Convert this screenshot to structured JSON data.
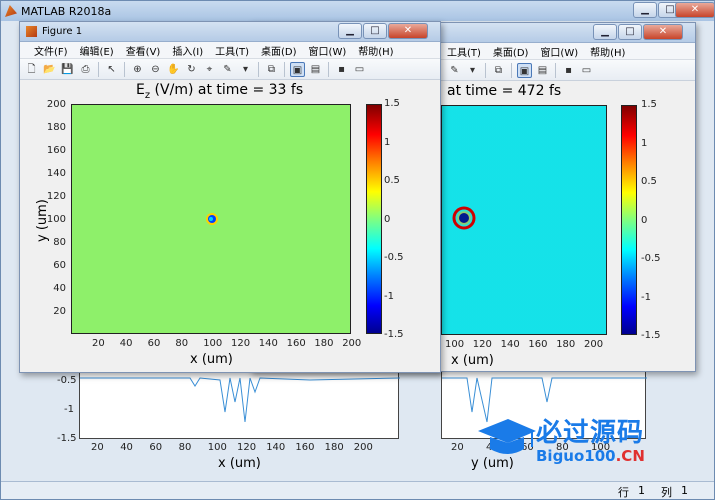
{
  "matlab": {
    "title": "MATLAB R2018a",
    "status": {
      "row_label": "行",
      "row_value": "1",
      "col_label": "列",
      "col_value": "1"
    }
  },
  "fig1": {
    "title": "Figure 1",
    "menus": [
      "文件(F)",
      "编辑(E)",
      "查看(V)",
      "插入(I)",
      "工具(T)",
      "桌面(D)",
      "窗口(W)",
      "帮助(H)"
    ],
    "plot_title": "E",
    "plot_title_sub": "z",
    "plot_title_rest": " (V/m) at time = 33 fs",
    "xlabel": "x (um)",
    "ylabel": "y (um)",
    "xticks": [
      "20",
      "40",
      "60",
      "80",
      "100",
      "120",
      "140",
      "160",
      "180",
      "200"
    ],
    "yticks": [
      "200",
      "180",
      "160",
      "140",
      "120",
      "100",
      "80",
      "60",
      "40",
      "20"
    ],
    "cbar_ticks": [
      "1.5",
      "1",
      "0.5",
      "0",
      "-0.5",
      "-1",
      "-1.5"
    ]
  },
  "fig2": {
    "menus": [
      "工具(T)",
      "桌面(D)",
      "窗口(W)",
      "帮助(H)"
    ],
    "plot_title": "at time = 472 fs",
    "xlabel": "x (um)",
    "xticks": [
      "100",
      "120",
      "140",
      "160",
      "180",
      "200"
    ],
    "cbar_ticks": [
      "1.5",
      "1",
      "0.5",
      "0",
      "-0.5",
      "-1",
      "-1.5"
    ]
  },
  "lower_left": {
    "xlabel": "x (um)",
    "xticks": [
      "20",
      "40",
      "60",
      "80",
      "100",
      "120",
      "140",
      "160",
      "180",
      "200"
    ],
    "yticks": [
      "-0.5",
      "-1",
      "-1.5"
    ]
  },
  "lower_right": {
    "xlabel": "y (um)",
    "xticks": [
      "20",
      "40",
      "60",
      "80",
      "100"
    ]
  },
  "watermark": {
    "text1": "必过源码",
    "text2a": "Biguo100",
    "text2b": ".CN"
  },
  "colors": {
    "field": "#8ef06a",
    "line": "#3a8fd6",
    "title_bar": "#b5cbe6"
  }
}
